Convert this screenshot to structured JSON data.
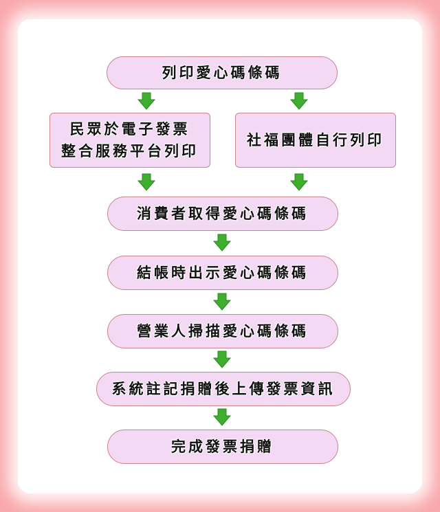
{
  "flowchart": {
    "steps": {
      "print_barcode": "列印愛心碼條碼",
      "public_print": "民眾於電子發票\n整合服務平台列印",
      "welfare_print": "社福團體自行列印",
      "consumer_obtain": "消費者取得愛心碼條碼",
      "show_at_checkout": "結帳時出示愛心碼條碼",
      "merchant_scan": "營業人掃描愛心碼條碼",
      "system_upload": "系統註記捐贈後上傳發票資訊",
      "donation_complete": "完成發票捐贈"
    },
    "colors": {
      "background": "#f9a9ad",
      "box_fill": "#f3d9f4",
      "box_border": "#c9858b",
      "arrow": "#3fae2f"
    }
  }
}
